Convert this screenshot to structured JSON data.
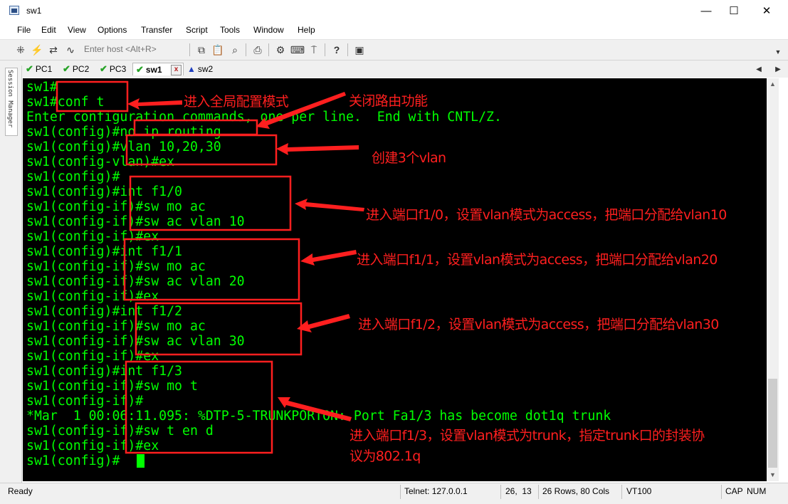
{
  "window": {
    "title": "sw1",
    "controls": [
      "—",
      "☐",
      "✕"
    ]
  },
  "menu": [
    "File",
    "Edit",
    "View",
    "Options",
    "Transfer",
    "Script",
    "Tools",
    "Window",
    "Help"
  ],
  "toolbar": {
    "host_placeholder": "Enter host <Alt+R>",
    "icons": [
      "connect-icon",
      "quick-connect-icon",
      "reconnect-icon",
      "disconnect-icon",
      "copy-icon",
      "paste-icon",
      "find-icon",
      "print-icon",
      "settings-icon",
      "keymap-icon",
      "sftp-icon",
      "help-icon",
      "session-icon"
    ]
  },
  "tabs": [
    {
      "label": "PC1",
      "status": "connected"
    },
    {
      "label": "PC2",
      "status": "connected"
    },
    {
      "label": "PC3",
      "status": "connected"
    },
    {
      "label": "sw1",
      "status": "connected",
      "active": true
    },
    {
      "label": "sw2",
      "status": "warning"
    }
  ],
  "session_manager": {
    "label": "Session Manager"
  },
  "terminal": {
    "colors": {
      "background": "#000000",
      "text": "#00ff00"
    },
    "lines": [
      "sw1#",
      "sw1#conf t",
      "Enter configuration commands, one per line.  End with CNTL/Z.",
      "sw1(config)#no ip routing",
      "sw1(config)#vlan 10,20,30",
      "sw1(config-vlan)#ex",
      "sw1(config)#",
      "sw1(config)#int f1/0",
      "sw1(config-if)#sw mo ac",
      "sw1(config-if)#sw ac vlan 10",
      "sw1(config-if)#ex",
      "sw1(config)#int f1/1",
      "sw1(config-if)#sw mo ac",
      "sw1(config-if)#sw ac vlan 20",
      "sw1(config-if)#ex",
      "sw1(config)#int f1/2",
      "sw1(config-if)#sw mo ac",
      "sw1(config-if)#sw ac vlan 30",
      "sw1(config-if)#ex",
      "sw1(config)#int f1/3",
      "sw1(config-if)#sw mo t",
      "sw1(config-if)#",
      "*Mar  1 00:06:11.095: %DTP-5-TRUNKPORTON: Port Fa1/3 has become dot1q trunk",
      "sw1(config-if)#sw t en d",
      "sw1(config-if)#ex",
      "sw1(config)#"
    ]
  },
  "annotations": {
    "color": "#ff1f1f",
    "notes": [
      "进入全局配置模式",
      "关闭路由功能",
      "创建3个vlan",
      "进入端口f1/0，设置vlan模式为access，把端口分配给vlan10",
      "进入端口f1/1，设置vlan模式为access，把端口分配给vlan20",
      "进入端口f1/2，设置vlan模式为access，把端口分配给vlan30",
      "进入端口f1/3，设置vlan模式为trunk，指定trunk口的封装协",
      "议为802.1q"
    ]
  },
  "status": {
    "ready": "Ready",
    "connection": "Telnet: 127.0.0.1",
    "cursor_pos": "26,  13",
    "size": "26 Rows, 80 Cols",
    "emulation": "VT100",
    "caps": "CAP",
    "num": "NUM"
  }
}
